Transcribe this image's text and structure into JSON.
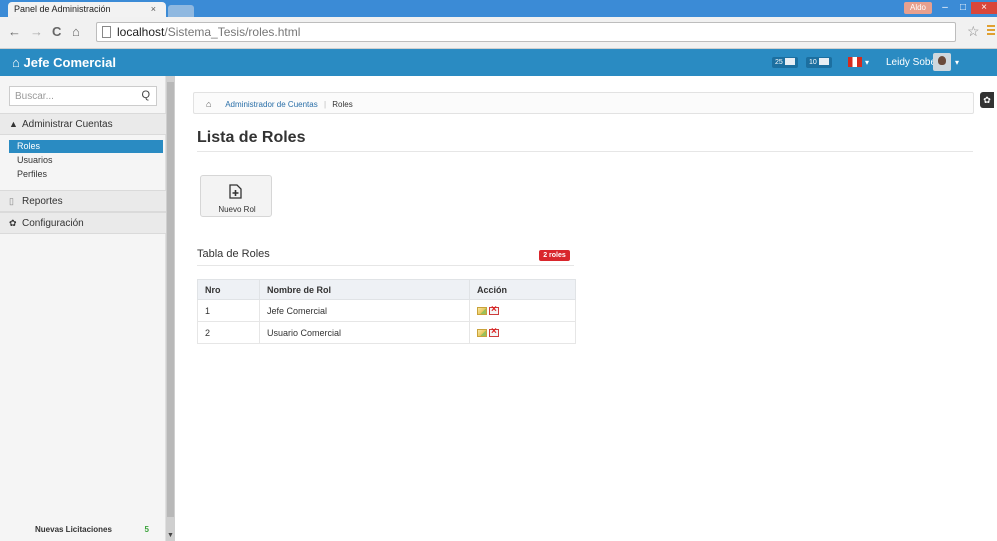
{
  "browser": {
    "tab_title": "Panel de Administración",
    "tab_close": "×",
    "window_user": "Aldo",
    "url_host": "localhost",
    "url_path": "/Sistema_Tesis/roles.html",
    "nav_back": "←",
    "nav_forward": "→",
    "nav_reload": "C",
    "nav_home": "⌂",
    "star": "☆",
    "win_min": "–",
    "win_max": "□",
    "win_close": "×"
  },
  "header": {
    "brand": "Jefe Comercial",
    "brand_icon": "home-icon",
    "badge_messages": "25",
    "badge_calendar": "10",
    "user_name": "Leidy Soberón",
    "caret": "▾"
  },
  "sidebar": {
    "search_placeholder": "Buscar...",
    "search_icon": "Q",
    "sections": [
      {
        "label": "Administrar Cuentas",
        "icon": "user-icon",
        "glyph": "▲"
      },
      {
        "label": "Reportes",
        "icon": "document-icon",
        "glyph": "▯"
      },
      {
        "label": "Configuración",
        "icon": "gear-icon",
        "glyph": "✿"
      }
    ],
    "sub_items": [
      "Roles",
      "Usuarios",
      "Perfiles"
    ],
    "active_item": "Roles",
    "footer_label": "Nuevas Licitaciones",
    "footer_count": "5"
  },
  "breadcrumb": {
    "home_glyph": "⌂",
    "link": "Administrador de Cuentas",
    "current": "Roles"
  },
  "main": {
    "page_title": "Lista de Roles",
    "new_button_label": "Nuevo Rol",
    "table_title": "Tabla de Roles",
    "table_badge": "2 roles",
    "columns": [
      "Nro",
      "Nombre de Rol",
      "Acción"
    ],
    "rows": [
      {
        "nro": "1",
        "nombre": "Jefe Comercial"
      },
      {
        "nro": "2",
        "nombre": "Usuario Comercial"
      }
    ]
  },
  "colors": {
    "accent": "#2a8bc2",
    "badge_red": "#d9262c"
  }
}
